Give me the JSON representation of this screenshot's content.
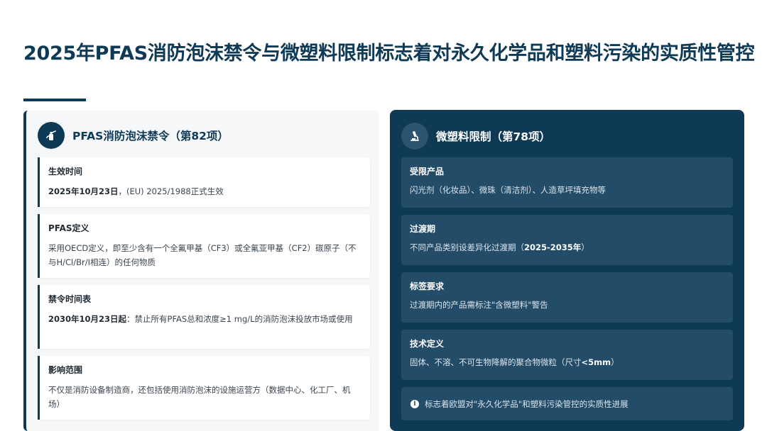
{
  "title": "2025年PFAS消防泡沫禁令与微塑料限制标志着对永久化学品和塑料污染的实质性管控",
  "left": {
    "heading": "PFAS消防泡沫禁令（第82项）",
    "icon": "fire-extinguisher-icon",
    "cards": [
      {
        "label": "生效时间",
        "bold": "2025年10月23日",
        "text": "，(EU) 2025/1988正式生效"
      },
      {
        "label": "PFAS定义",
        "bold": "",
        "text": "采用OECD定义，即至少含有一个全氟甲基（CF3）或全氟亚甲基（CF2）碳原子（不与H/Cl/Br/I相连）的任何物质"
      },
      {
        "label": "禁令时间表",
        "bold": "2030年10月23日起",
        "text": "：禁止所有PFAS总和浓度≥1 mg/L的消防泡沫投放市场或使用"
      },
      {
        "label": "影响范围",
        "bold": "",
        "text": "不仅是消防设备制造商，还包括使用消防泡沫的设施运营方（数据中心、化工厂、机场）"
      }
    ]
  },
  "right": {
    "heading": "微塑料限制（第78项）",
    "icon": "microscope-icon",
    "cards": [
      {
        "label": "受限产品",
        "pre": "闪光剂（化妆品）、微珠（清洁剂）、人造草坪填充物等",
        "bold": "",
        "post": ""
      },
      {
        "label": "过渡期",
        "pre": "不同产品类别设差异化过渡期（",
        "bold": "2025-2035年",
        "post": "）"
      },
      {
        "label": "标签要求",
        "pre": "过渡期内的产品需标注\"含微塑料\"警告",
        "bold": "",
        "post": ""
      },
      {
        "label": "技术定义",
        "pre": "固体、不溶、不可生物降解的聚合物微粒（尺寸",
        "bold": "<5mm",
        "post": "）"
      }
    ],
    "note_icon": "info-icon",
    "note": "标志着欧盟对\"永久化学品\"和塑料污染管控的实质性进展"
  },
  "colors": {
    "navy": "#0e3a56",
    "card_dark": "#234c69",
    "panel_light": "#f5f7f9"
  }
}
